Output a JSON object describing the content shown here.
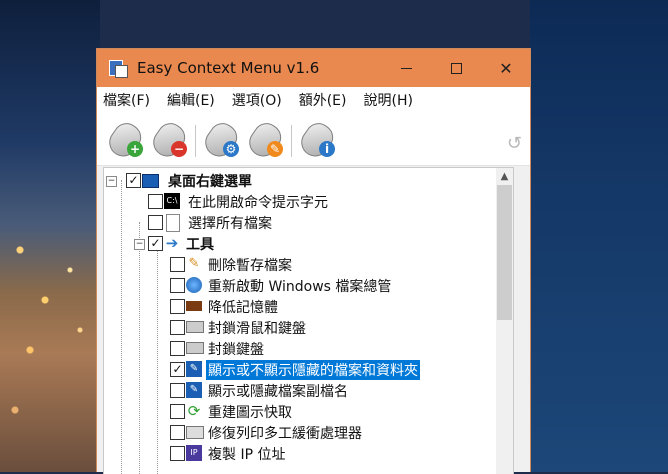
{
  "window": {
    "title": "Easy Context Menu v1.6"
  },
  "menubar": {
    "items": [
      "檔案(F)",
      "編輯(E)",
      "選項(O)",
      "額外(E)",
      "說明(H)"
    ]
  },
  "toolbar": {
    "buttons": [
      {
        "name": "add",
        "icon": "mouse-add-icon",
        "badge": "+",
        "badge_color": "#3aa53a"
      },
      {
        "name": "remove",
        "icon": "mouse-remove-icon",
        "badge": "−",
        "badge_color": "#d9352a"
      },
      {
        "name": "settings",
        "icon": "mouse-settings-icon",
        "badge": "⚙",
        "badge_color": "#2b78c8"
      },
      {
        "name": "clean",
        "icon": "mouse-clean-icon",
        "badge": "✎",
        "badge_color": "#f08a1c"
      },
      {
        "name": "info",
        "icon": "mouse-info-icon",
        "badge": "i",
        "badge_color": "#2b78c8"
      }
    ],
    "undo_icon": "undo-icon"
  },
  "tree": {
    "root_label": "桌面右鍵選單",
    "items": [
      {
        "label": "在此開啟命令提示字元",
        "checked": false,
        "icon": "cmd-icon"
      },
      {
        "label": "選擇所有檔案",
        "checked": false,
        "icon": "file-icon"
      },
      {
        "label": "工具",
        "checked": true,
        "icon": "arrow-icon",
        "group": true
      },
      {
        "label": "刪除暫存檔案",
        "checked": false,
        "icon": "broom-icon"
      },
      {
        "label": "重新啟動 Windows 檔案總管",
        "checked": false,
        "icon": "explorer-icon"
      },
      {
        "label": "降低記憶體",
        "checked": false,
        "icon": "memory-icon"
      },
      {
        "label": "封鎖滑鼠和鍵盤",
        "checked": false,
        "icon": "keyboard-mouse-block-icon"
      },
      {
        "label": "封鎖鍵盤",
        "checked": false,
        "icon": "keyboard-block-icon"
      },
      {
        "label": "顯示或不顯示隱藏的檔案和資料夾",
        "checked": true,
        "icon": "edit-icon",
        "selected": true
      },
      {
        "label": "顯示或隱藏檔案副檔名",
        "checked": false,
        "icon": "edit-icon"
      },
      {
        "label": "重建圖示快取",
        "checked": false,
        "icon": "refresh-icon"
      },
      {
        "label": "修復列印多工緩衝處理器",
        "checked": false,
        "icon": "printer-icon"
      },
      {
        "label": "複製 IP 位址",
        "checked": false,
        "icon": "ip-icon"
      }
    ]
  },
  "colors": {
    "titlebar": "#e9894f",
    "selection": "#0078d7"
  }
}
